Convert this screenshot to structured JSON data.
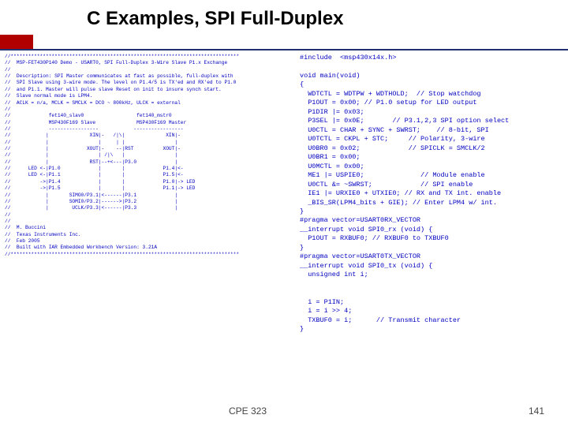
{
  "title": "C Examples, SPI Full-Duplex",
  "left_code": "//******************************************************************************\n//  MSP-FET430P140 Demo - USART0, SPI Full-Duplex 3-Wire Slave P1.x Exchange\n//\n//  Description: SPI Master communicates at fast as possible, full-duplex with\n//  SPI Slave using 3-wire mode. The level on P1.4/5 is TX'ed and RX'ed to P1.0\n//  and P1.1. Master will pulse slave Reset on init to insure synch start.\n//  Slave normal mode is LPM4.\n//  ACLK = n/a, MCLK = SMCLK = DCO ~ 800kHz, ULCK = external\n//\n//             fet140_slav0                  fet140_mstr0\n//             MSP430F169 Slave              MSP430F169 Master\n//             -----------------            -----------------\n//            |              XIN|-   /|\\|              XIN|-\n//            |                 |     | |                 |\n//            |             XOUT|-    --|RST          XOUT|-\n//            |                 | /|\\   |                 |\n//            |              RST|--+<---|P3.0             |\n//      LED <-|P1.0             |       |             P1.4|<-\n//      LED <-|P1.1             |       |             P1.5|<-\n//          ->|P1.4             |       |             P1.0|-> LED\n//          ->|P1.5             |       |             P1.1|-> LED\n//            |       SIMO0/P3.1|<------|P3.1             |\n//            |       SOMI0/P3.2|------>|P3.2             |\n//            |        UCLK/P3.3|<------|P3.3             |\n//\n//\n//  M. Buccini\n//  Texas Instruments Inc.\n//  Feb 2005\n//  Built with IAR Embedded Workbench Version: 3.21A\n//******************************************************************************",
  "right_code": "#include  <msp430x14x.h>\n\nvoid main(void)\n{\n  WDTCTL = WDTPW + WDTHOLD;  // Stop watchdog\n  P1OUT = 0x00; // P1.0 setup for LED output\n  P1DIR |= 0x03;\n  P3SEL |= 0x0E;       // P3.1,2,3 SPI option select\n  U0CTL = CHAR + SYNC + SWRST;    // 8-bit, SPI\n  U0TCTL = CKPL + STC;     // Polarity, 3-wire\n  U0BR0 = 0x02;            // SPICLK = SMCLK/2\n  U0BR1 = 0x00;\n  U0MCTL = 0x00;\n  ME1 |= USPIE0;              // Module enable\n  U0CTL &= ~SWRST;            // SPI enable\n  IE1 |= URXIE0 + UTXIE0; // RX and TX int. enable\n  _BIS_SR(LPM4_bits + GIE); // Enter LPM4 w/ int.\n}\n#pragma vector=USART0RX_VECTOR\n__interrupt void SPI0_rx (void) {\n  P1OUT = RXBUF0; // RXBUF0 to TXBUF0\n}\n#pragma vector=USART0TX_VECTOR\n__interrupt void SPI0_tx (void) {\n  unsigned int i;\n\n\n  i = P1IN;\n  i = i >> 4;\n  TXBUF0 = i;      // Transmit character\n}",
  "footer_left": "CPE 323",
  "footer_right": "141"
}
